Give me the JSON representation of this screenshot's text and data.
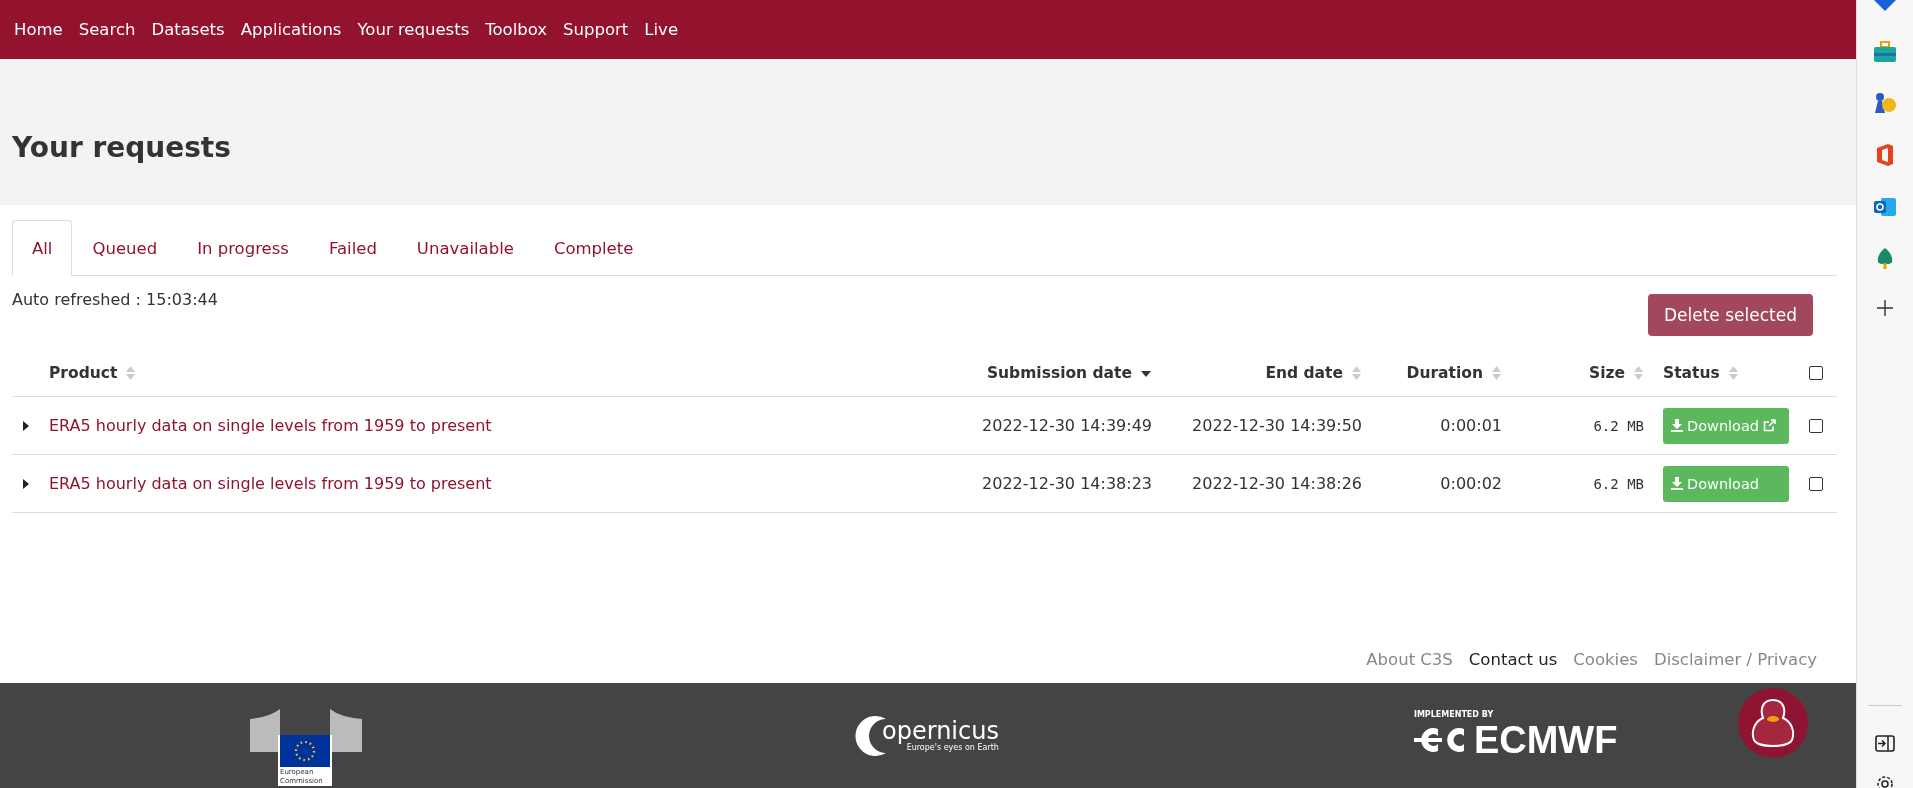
{
  "nav": [
    {
      "label": "Home"
    },
    {
      "label": "Search"
    },
    {
      "label": "Datasets"
    },
    {
      "label": "Applications"
    },
    {
      "label": "Your requests"
    },
    {
      "label": "Toolbox"
    },
    {
      "label": "Support"
    },
    {
      "label": "Live"
    }
  ],
  "page_title": "Your requests",
  "tabs": [
    {
      "label": "All",
      "selected": true
    },
    {
      "label": "Queued",
      "selected": false
    },
    {
      "label": "In progress",
      "selected": false
    },
    {
      "label": "Failed",
      "selected": false
    },
    {
      "label": "Unavailable",
      "selected": false
    },
    {
      "label": "Complete",
      "selected": false
    }
  ],
  "auto_refreshed": "Auto refreshed : 15:03:44",
  "delete_button": "Delete selected",
  "table": {
    "columns": [
      {
        "label": "Product",
        "sorted": false,
        "kind": "text"
      },
      {
        "label": "Submission date",
        "sorted": true,
        "kind": "numeric"
      },
      {
        "label": "End date",
        "sorted": false,
        "kind": "numeric"
      },
      {
        "label": "Duration",
        "sorted": false,
        "kind": "numeric"
      },
      {
        "label": "Size",
        "sorted": false,
        "kind": "numeric"
      },
      {
        "label": "Status",
        "sorted": false,
        "kind": "text"
      }
    ],
    "select_all_checked": false,
    "rows": [
      {
        "product": "ERA5 hourly data on single levels from 1959 to present",
        "submission_date": "2022-12-30 14:39:49",
        "end_date": "2022-12-30 14:39:50",
        "duration": "0:00:01",
        "size": "6.2 MB",
        "status": "Download",
        "external_link": true,
        "checked": false
      },
      {
        "product": "ERA5 hourly data on single levels from 1959 to present",
        "submission_date": "2022-12-30 14:38:23",
        "end_date": "2022-12-30 14:38:26",
        "duration": "0:00:02",
        "size": "6.2 MB",
        "status": "Download",
        "external_link": false,
        "checked": false
      }
    ]
  },
  "footer_links": [
    {
      "label": "About C3S",
      "highlighted": false
    },
    {
      "label": "Contact us",
      "highlighted": true
    },
    {
      "label": "Cookies",
      "highlighted": false
    },
    {
      "label": "Disclaimer / Privacy",
      "highlighted": false
    }
  ],
  "footer_logos": {
    "ec": [
      "European",
      "Commission"
    ],
    "copernicus": {
      "name": "opernicus",
      "tagline": "Europe's eyes on Earth"
    },
    "ecmwf": {
      "caption": "IMPLEMENTED BY",
      "name": "ECMWF"
    }
  }
}
